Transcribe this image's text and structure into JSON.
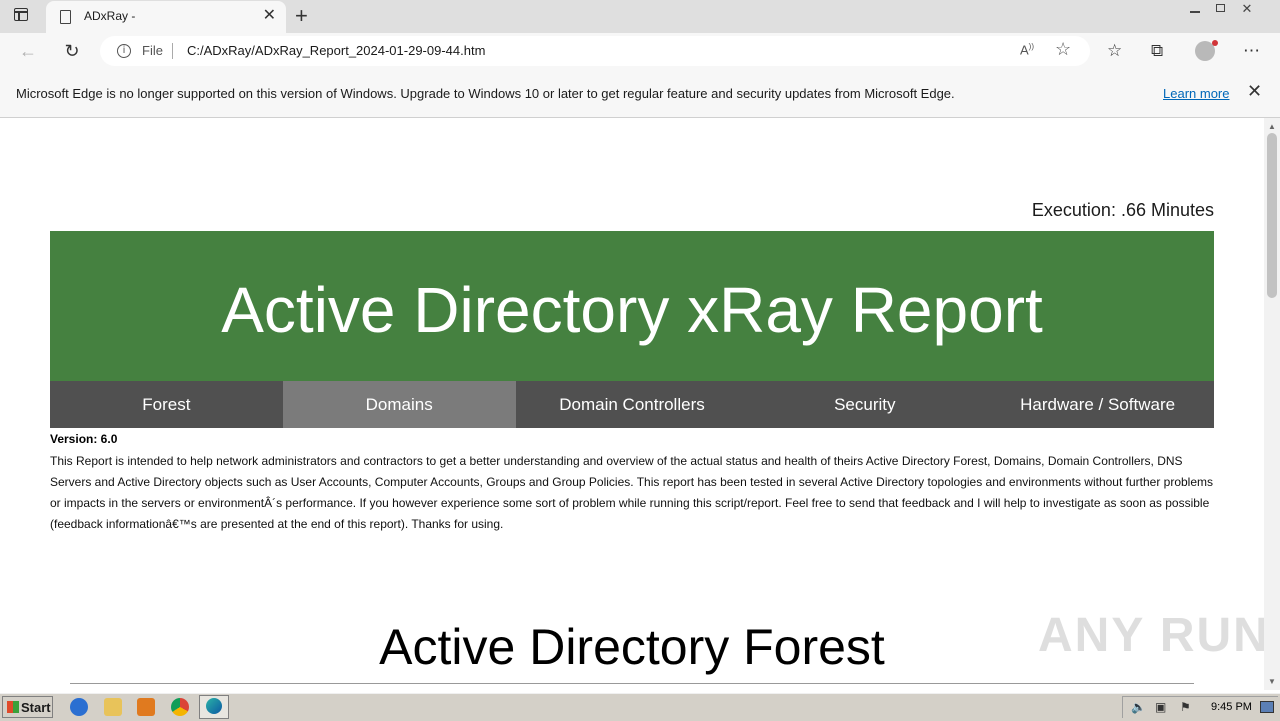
{
  "browser": {
    "tab_title": "ADxRay -",
    "address_prefix": "File",
    "url": "C:/ADxRay/ADxRay_Report_2024-01-29-09-44.htm",
    "infobar": {
      "message": "Microsoft Edge is no longer supported on this version of Windows. Upgrade to Windows 10 or later to get regular feature and security updates from Microsoft Edge.",
      "link": "Learn more"
    }
  },
  "report": {
    "execution": "Execution: .66 Minutes",
    "title": "Active Directory xRay Report",
    "nav": [
      "Forest",
      "Domains",
      "Domain Controllers",
      "Security",
      "Hardware / Software"
    ],
    "active_nav": "Domains",
    "version": "Version: 6.0",
    "description": "This Report is intended to help network administrators and contractors to get a better understanding and overview of the actual status and health of theirs Active Directory Forest, Domains, Domain Controllers, DNS Servers and Active Directory objects such as User Accounts, Computer Accounts, Groups and Group Policies. This report has been tested in several Active Directory topologies and environments without further problems or impacts in the servers or environmentÂ´s performance. If you however experience some sort of problem while running this script/report. Feel free to send that feedback and I will help to investigate as soon as possible (feedback informationâ€™s are presented at the end of this report). Thanks for using.",
    "section_title": "Active Directory Forest"
  },
  "watermark": "ANY RUN",
  "taskbar": {
    "start_label": "Start",
    "clock": "9:45 PM"
  },
  "colors": {
    "banner": "#458140",
    "nav_bg": "#505050",
    "nav_active": "#7b7b7b",
    "link": "#0067b8"
  }
}
